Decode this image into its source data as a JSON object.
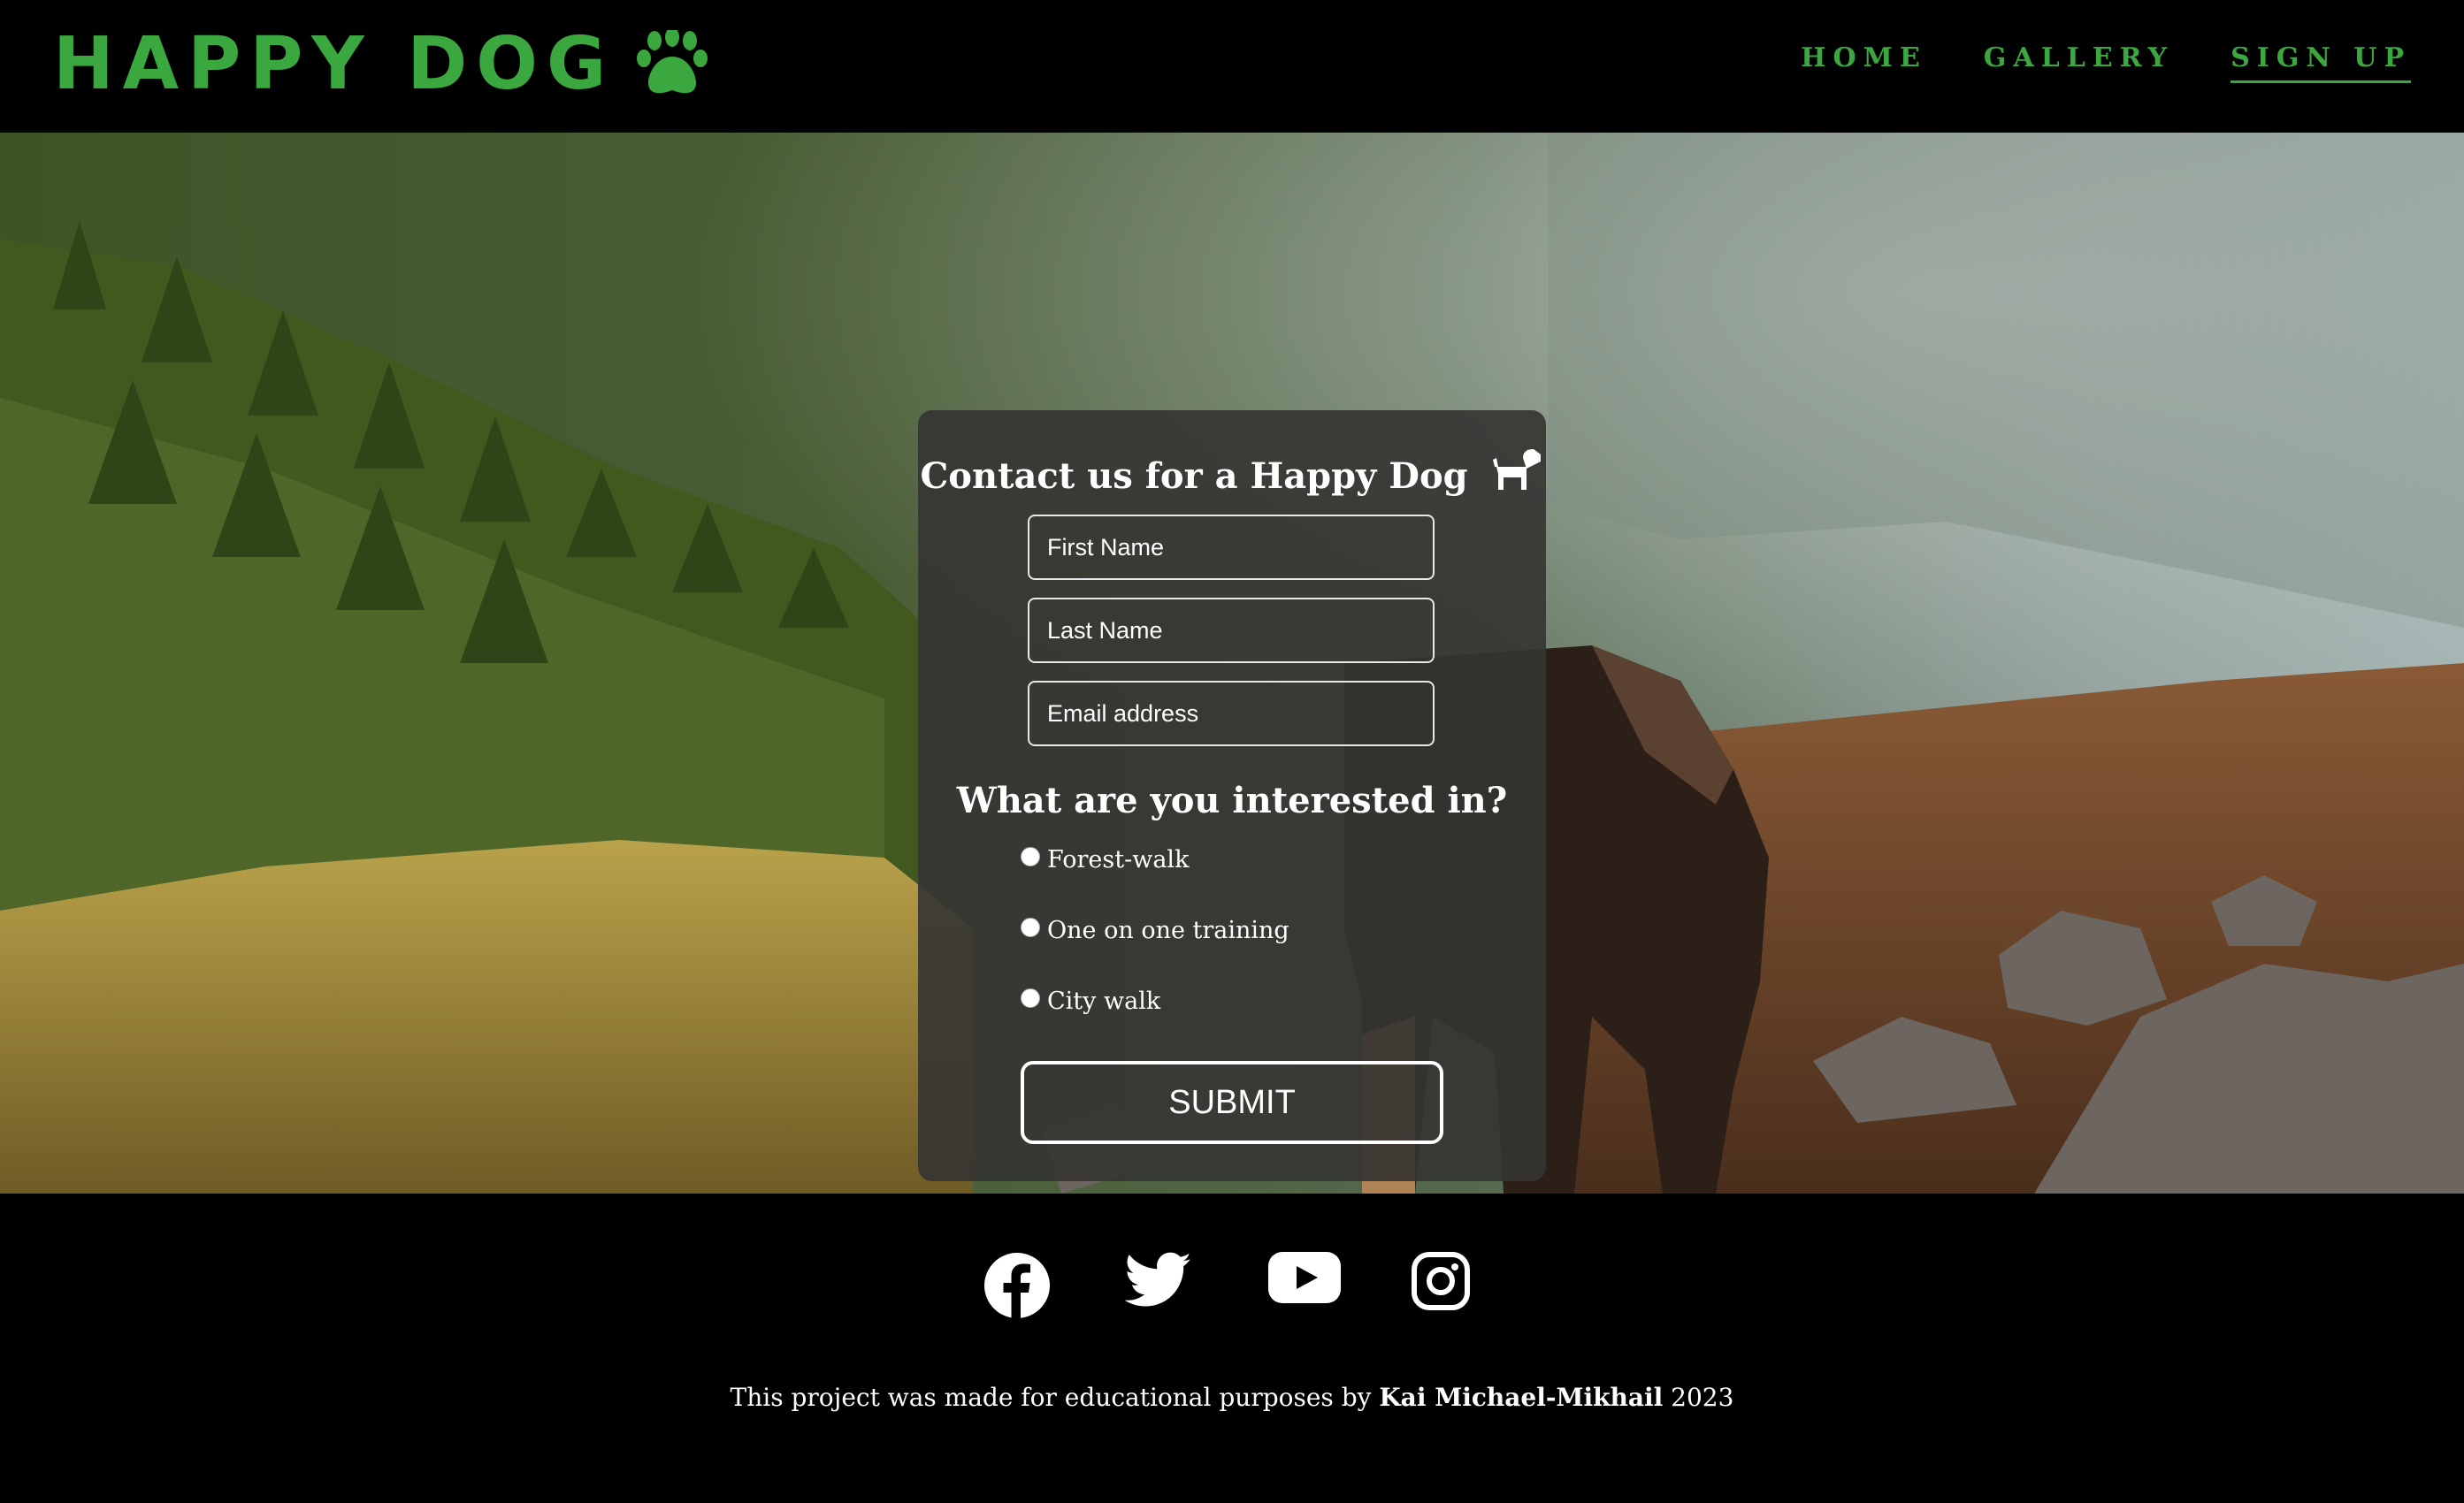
{
  "brand": {
    "name": "HAPPY DOG",
    "icon": "paw-icon",
    "color": "#3aa83f"
  },
  "nav": {
    "items": [
      {
        "label": "HOME",
        "active": false
      },
      {
        "label": "GALLERY",
        "active": false
      },
      {
        "label": "SIGN UP",
        "active": true
      }
    ]
  },
  "form": {
    "title": "Contact us for a Happy Dog",
    "title_icon": "dog-icon",
    "first_name_placeholder": "First Name",
    "last_name_placeholder": "Last Name",
    "email_placeholder": "Email address",
    "interest_heading": "What are you interested in?",
    "options": [
      "Forest-walk",
      "One on one training",
      "City walk"
    ],
    "submit_label": "SUBMIT"
  },
  "footer": {
    "social_icons": [
      "facebook-icon",
      "twitter-icon",
      "youtube-icon",
      "instagram-icon"
    ],
    "credit_prefix": "This project was made for educational purposes by",
    "credit_author": "Kai Michael-Mikhail",
    "credit_year": "2023"
  }
}
